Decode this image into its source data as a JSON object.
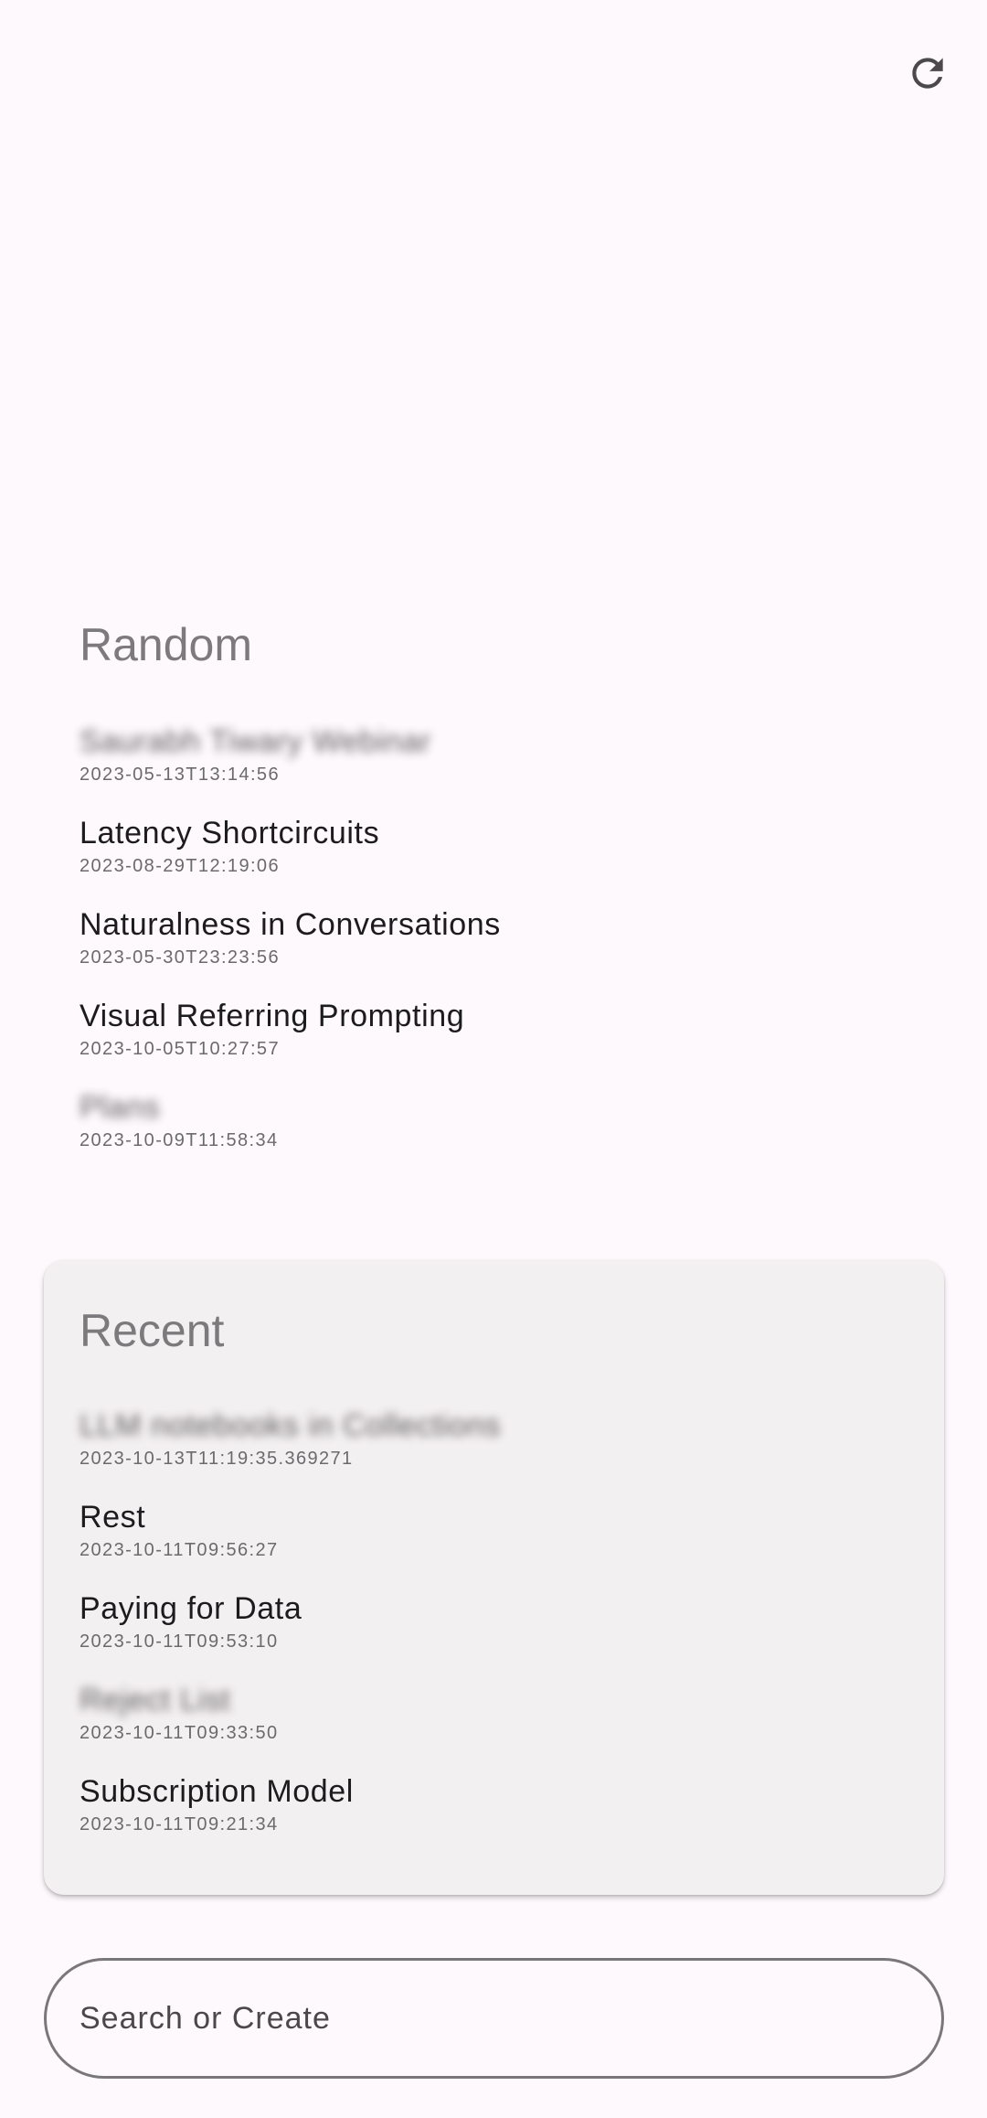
{
  "header": {
    "refresh_icon": "refresh-icon"
  },
  "random": {
    "title": "Random",
    "items": [
      {
        "title": "Saurabh Tiwary Webinar",
        "date": "2023-05-13T13:14:56"
      },
      {
        "title": "Latency Shortcircuits",
        "date": "2023-08-29T12:19:06"
      },
      {
        "title": "Naturalness in Conversations",
        "date": "2023-05-30T23:23:56"
      },
      {
        "title": "Visual Referring Prompting",
        "date": "2023-10-05T10:27:57"
      },
      {
        "title": "Plans",
        "date": "2023-10-09T11:58:34"
      }
    ]
  },
  "recent": {
    "title": "Recent",
    "items": [
      {
        "title": "LLM notebooks in Collections",
        "date": "2023-10-13T11:19:35.369271"
      },
      {
        "title": "Rest",
        "date": "2023-10-11T09:56:27"
      },
      {
        "title": "Paying for Data",
        "date": "2023-10-11T09:53:10"
      },
      {
        "title": "Reject List",
        "date": "2023-10-11T09:33:50"
      },
      {
        "title": "Subscription Model",
        "date": "2023-10-11T09:21:34"
      }
    ]
  },
  "search": {
    "placeholder": "Search or Create"
  }
}
